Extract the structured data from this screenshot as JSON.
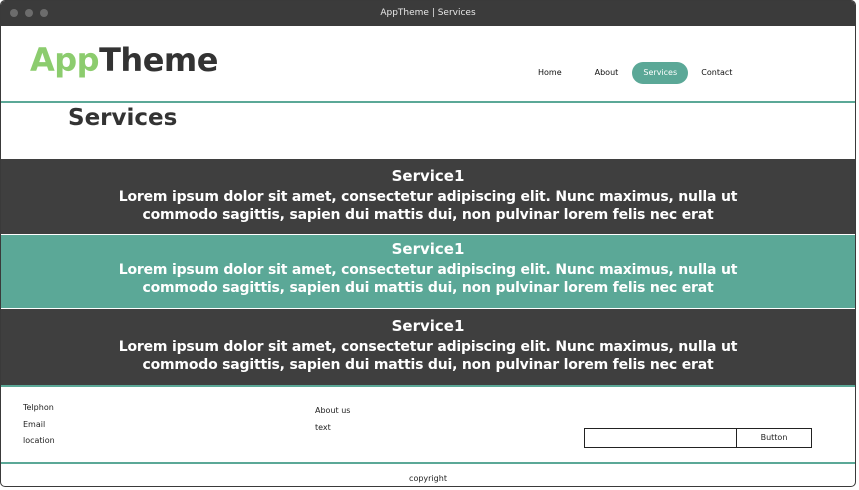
{
  "window": {
    "title": "AppTheme | Services"
  },
  "header": {
    "logo": {
      "part1": "App",
      "part2": "Theme"
    },
    "nav": [
      {
        "label": "Home"
      },
      {
        "label": "About"
      },
      {
        "label": "Services",
        "active": true
      },
      {
        "label": "Contact"
      }
    ]
  },
  "page": {
    "title": "Services"
  },
  "services": [
    {
      "title": "Service1",
      "text": "Lorem ipsum dolor sit amet, consectetur adipiscing elit. Nunc maximus, nulla ut commodo sagittis, sapien dui mattis dui, non pulvinar lorem felis nec erat"
    },
    {
      "title": "Service1",
      "text": "Lorem ipsum dolor sit amet, consectetur adipiscing elit. Nunc maximus, nulla ut commodo sagittis, sapien dui mattis dui, non pulvinar lorem felis nec erat"
    },
    {
      "title": "Service1",
      "text": "Lorem ipsum dolor sit amet, consectetur adipiscing elit. Nunc maximus, nulla ut commodo sagittis, sapien dui mattis dui, non pulvinar lorem felis nec erat"
    }
  ],
  "footer": {
    "contact": [
      "Telphon",
      "Email",
      "location"
    ],
    "about": [
      "About us",
      "text"
    ],
    "input": {
      "value": "",
      "placeholder": ""
    },
    "button_label": "Button",
    "copyright": "copyright"
  },
  "colors": {
    "accent": "#5ba897",
    "logo_green": "#8ccc6e",
    "dark_band": "#3f3f3f",
    "titlebar": "#3b3b3b"
  }
}
